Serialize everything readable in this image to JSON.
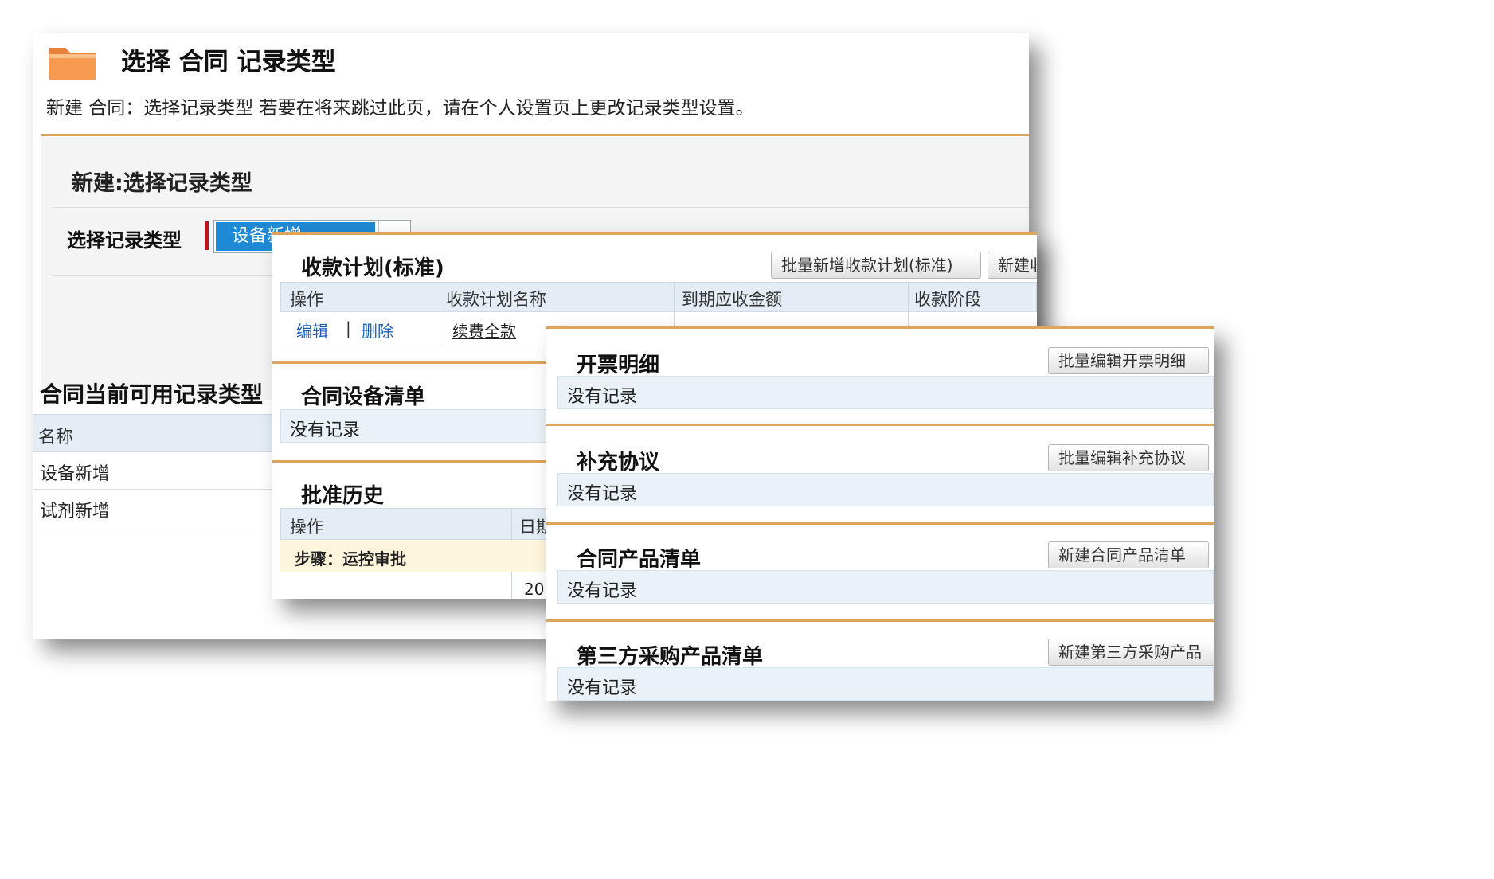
{
  "panel1": {
    "page_title": "选择 合同 记录类型",
    "description": "新建 合同：选择记录类型 若要在将来跳过此页，请在个人设置页上更改记录类型设置。",
    "section_title": "新建:选择记录类型",
    "select_label": "选择记录类型",
    "select_value": "设备新增",
    "available_title": "合同当前可用记录类型",
    "table_header": "名称",
    "rows": [
      "设备新增",
      "试剂新增"
    ]
  },
  "panel2": {
    "payment_plan": {
      "title": "收款计划(标准)",
      "batch_button": "批量新增收款计划(标准)",
      "new_button": "新建收",
      "headers": [
        "操作",
        "收款计划名称",
        "到期应收金额",
        "收款阶段"
      ],
      "row": {
        "edit": "编辑",
        "separator": "|",
        "delete": "删除",
        "name": "续费全款"
      }
    },
    "equipment_list": {
      "title": "合同设备清单",
      "empty": "没有记录"
    },
    "approval_history": {
      "title": "批准历史",
      "headers": [
        "操作",
        "日期"
      ],
      "step_label": "步骤：运控审批",
      "date_fragment": "20"
    }
  },
  "panel3": {
    "sections": [
      {
        "title": "开票明细",
        "button": "批量编辑开票明细",
        "empty": "没有记录"
      },
      {
        "title": "补充协议",
        "button": "批量编辑补充协议",
        "empty": "没有记录"
      },
      {
        "title": "合同产品清单",
        "button": "新建合同产品清单",
        "empty": "没有记录"
      },
      {
        "title": "第三方采购产品清单",
        "button": "新建第三方采购产品",
        "empty": "没有记录"
      }
    ]
  },
  "colors": {
    "accent_orange": "#e0a35a",
    "select_blue": "#1e8ad6",
    "link_blue": "#1a5fb4",
    "header_bg": "#e4edf5",
    "highlight_row": "#fdf5dc",
    "required_red": "#c1121f"
  },
  "icons": {
    "folder": "folder-icon",
    "dropdown": "chevron-down-icon"
  }
}
